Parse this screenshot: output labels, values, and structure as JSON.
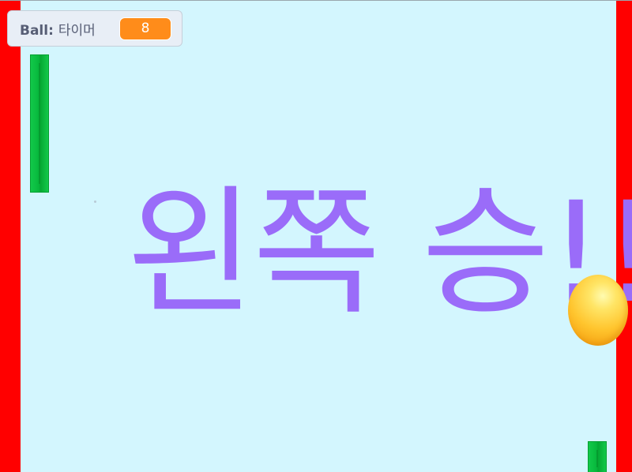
{
  "monitor": {
    "sprite": "Ball:",
    "variable": "타이머",
    "value": "8"
  },
  "message": "왼쪽 승!!",
  "colors": {
    "background": "#d3f6fe",
    "wall": "#ff0000",
    "paddle": "#07b83c",
    "message": "#9a6cf9",
    "ball": "#ffc52e",
    "monitor_value": "#ff8c1a"
  }
}
